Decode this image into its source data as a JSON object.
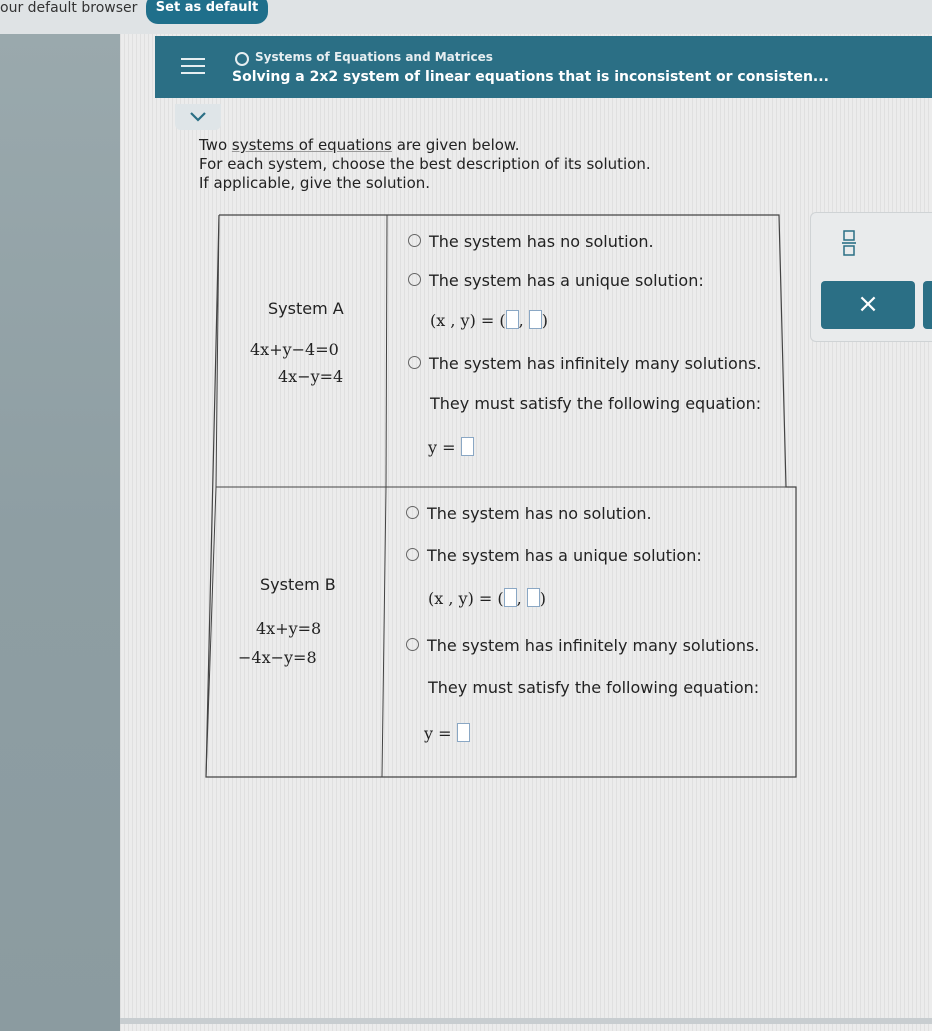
{
  "browser_bar": {
    "message": "our default browser",
    "set_default_label": "Set as default"
  },
  "header": {
    "topic": "Systems of Equations and Matrices",
    "title": "Solving a 2x2 system of linear equations that is inconsistent or consisten..."
  },
  "instructions": {
    "line1_pre": "Two ",
    "line1_link": "systems of equations",
    "line1_post": " are given below.",
    "line2": "For each system, choose the best description of its solution.",
    "line3": "If applicable, give the solution."
  },
  "systems": [
    {
      "label": "System A",
      "eq1": "4x+y−4=0",
      "eq2": "4x−y=4",
      "opt_none": "The system has no solution.",
      "opt_unique": "The system has a unique solution:",
      "pair_lhs": "(x , y) =",
      "opt_infinite": "The system has infinitely many solutions.",
      "satisfy": "They must satisfy the following equation:",
      "y_lhs": "y ="
    },
    {
      "label": "System B",
      "eq1": "4x+y=8",
      "eq2": "−4x−y=8",
      "opt_none": "The system has no solution.",
      "opt_unique": "The system has a unique solution:",
      "pair_lhs": "(x , y) =",
      "opt_infinite": "The system has infinitely many solutions.",
      "satisfy": "They must satisfy the following equation:",
      "y_lhs": "y ="
    }
  ],
  "side_panel": {
    "fraction_icon": "fraction-icon",
    "close_label": "×"
  },
  "colors": {
    "header": "#2b6f85",
    "button": "#1f6f8b",
    "input_border": "#8aa7c4"
  }
}
